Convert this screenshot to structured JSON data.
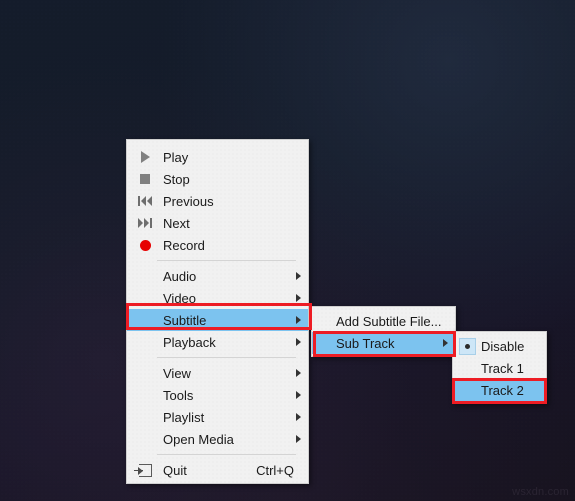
{
  "desktop": {
    "watermark": "wsxdn.com",
    "background_color": "#141c2b"
  },
  "colors": {
    "menu_background": "#f1f1f1",
    "highlight_blue": "#7cc3ef",
    "annotation_red": "#ed1c24",
    "record_red": "#e60000",
    "text": "#1a1a1a"
  },
  "context_menu": {
    "name": "player-context-menu",
    "groups": [
      {
        "items": [
          {
            "label": "Play",
            "icon": "play-icon",
            "submenu": false,
            "accel": ""
          },
          {
            "label": "Stop",
            "icon": "stop-icon",
            "submenu": false,
            "accel": ""
          },
          {
            "label": "Previous",
            "icon": "previous-icon",
            "submenu": false,
            "accel": ""
          },
          {
            "label": "Next",
            "icon": "next-icon",
            "submenu": false,
            "accel": ""
          },
          {
            "label": "Record",
            "icon": "record-icon",
            "submenu": false,
            "accel": ""
          }
        ]
      },
      {
        "items": [
          {
            "label": "Audio",
            "icon": "",
            "submenu": true,
            "accel": "",
            "highlighted": false
          },
          {
            "label": "Video",
            "icon": "",
            "submenu": true,
            "accel": "",
            "highlighted": false
          },
          {
            "label": "Subtitle",
            "icon": "",
            "submenu": true,
            "accel": "",
            "highlighted": true
          },
          {
            "label": "Playback",
            "icon": "",
            "submenu": true,
            "accel": "",
            "highlighted": false
          }
        ]
      },
      {
        "items": [
          {
            "label": "View",
            "icon": "",
            "submenu": true,
            "accel": ""
          },
          {
            "label": "Tools",
            "icon": "",
            "submenu": true,
            "accel": ""
          },
          {
            "label": "Playlist",
            "icon": "",
            "submenu": true,
            "accel": ""
          },
          {
            "label": "Open Media",
            "icon": "",
            "submenu": true,
            "accel": ""
          }
        ]
      },
      {
        "items": [
          {
            "label": "Quit",
            "icon": "quit-icon",
            "submenu": false,
            "accel": "Ctrl+Q"
          }
        ]
      }
    ]
  },
  "subtitle_submenu": {
    "name": "subtitle-submenu",
    "items": [
      {
        "label": "Add Subtitle File...",
        "submenu": false,
        "highlighted": false
      },
      {
        "label": "Sub Track",
        "submenu": true,
        "highlighted": true
      }
    ]
  },
  "sub_track_submenu": {
    "name": "sub-track-submenu",
    "items": [
      {
        "label": "Disable",
        "selected": true,
        "highlighted": false
      },
      {
        "label": "Track 1",
        "selected": false,
        "highlighted": false
      },
      {
        "label": "Track 2",
        "selected": false,
        "highlighted": true
      }
    ]
  },
  "annotations": [
    {
      "target": "Subtitle",
      "color": "#ed1c24"
    },
    {
      "target": "Sub Track",
      "color": "#ed1c24"
    },
    {
      "target": "Track 2",
      "color": "#ed1c24"
    }
  ]
}
